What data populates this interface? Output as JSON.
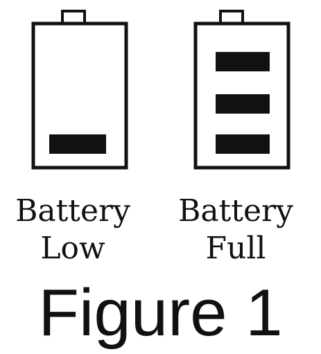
{
  "figure": {
    "title": "Figure 1"
  },
  "batteries": [
    {
      "id": "low",
      "label_line1": "Battery",
      "label_line2": "Low",
      "charge_bars": 1,
      "max_bars": 3
    },
    {
      "id": "full",
      "label_line1": "Battery",
      "label_line2": "Full",
      "charge_bars": 3,
      "max_bars": 3
    }
  ],
  "colors": {
    "ink": "#111111",
    "background": "#ffffff"
  }
}
